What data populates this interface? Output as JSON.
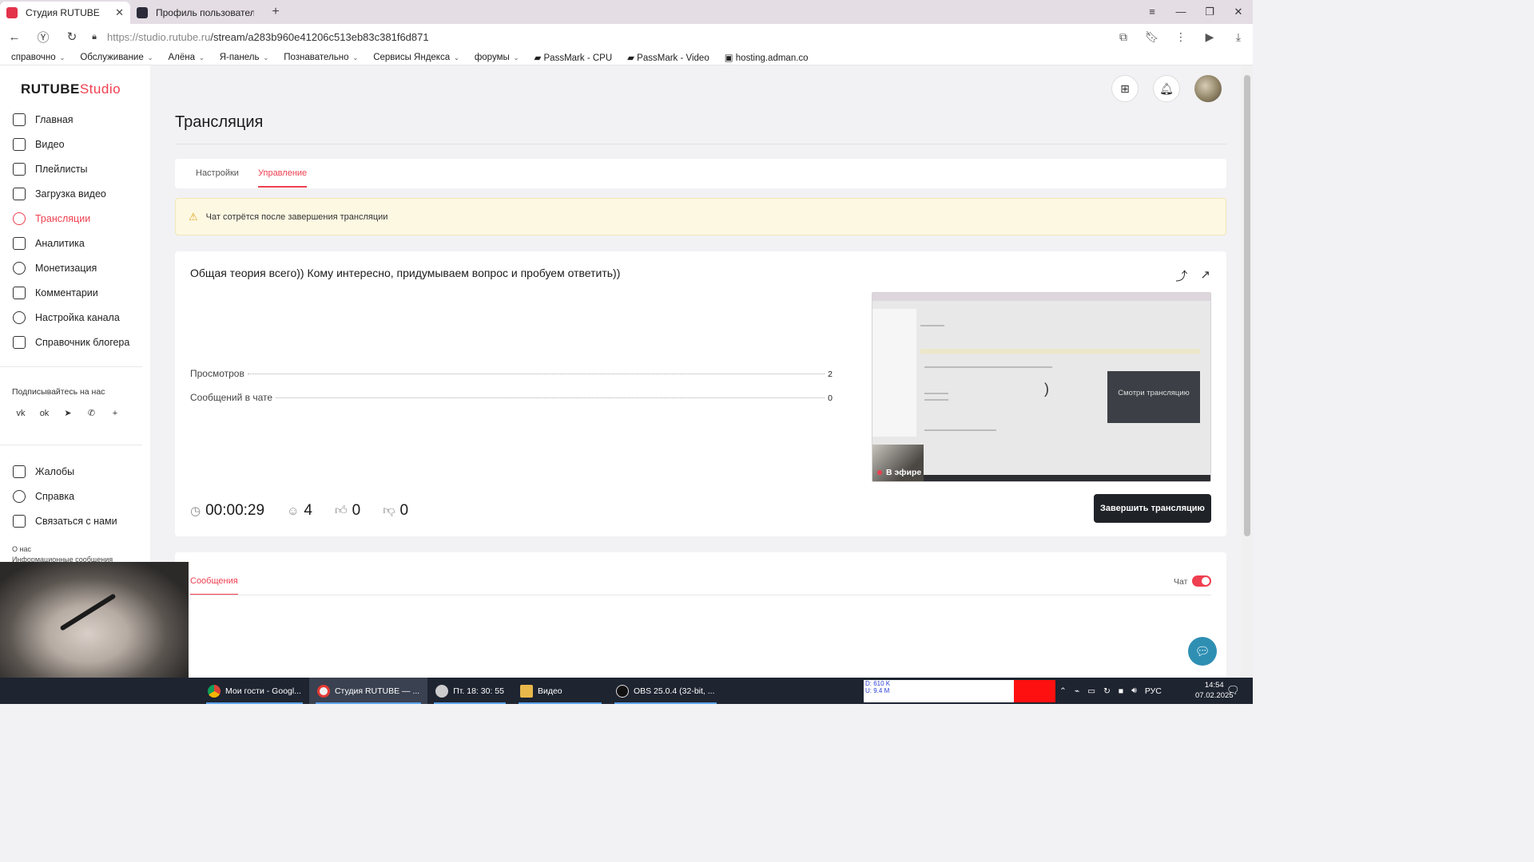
{
  "browser": {
    "tabs": [
      {
        "title": "Студия RUTUBE",
        "favicon_color": "#e3324a"
      },
      {
        "title": "Профиль пользователя К",
        "favicon_color": "#2b2b3a"
      }
    ],
    "url_host": "https://studio.rutube.ru",
    "url_path": "/stream/a283b960e41206c513eb83c381f6d871",
    "bookmarks": [
      "справочно",
      "Обслуживание",
      "Алёна",
      "Я-панель",
      "Познавательно",
      "Сервисы Яндекса",
      "форумы",
      "PassMark - CPU",
      "PassMark - Video",
      "hosting.adman.co"
    ]
  },
  "logo": {
    "main": "RUTUBE",
    "sub": "Studio"
  },
  "sidebar": {
    "items": [
      {
        "label": "Главная"
      },
      {
        "label": "Видео"
      },
      {
        "label": "Плейлисты"
      },
      {
        "label": "Загрузка видео"
      },
      {
        "label": "Трансляции"
      },
      {
        "label": "Аналитика"
      },
      {
        "label": "Монетизация"
      },
      {
        "label": "Комментарии"
      },
      {
        "label": "Настройка канала"
      },
      {
        "label": "Справочник блогера"
      }
    ],
    "subscribe_title": "Подписывайтесь на нас",
    "socials": [
      "vk",
      "ok",
      "tg",
      "viber",
      "+"
    ],
    "bottom_items": [
      {
        "label": "Жалобы"
      },
      {
        "label": "Справка"
      },
      {
        "label": "Связаться с нами"
      }
    ],
    "about": "О нас",
    "info_messages": "Информационные сообщения"
  },
  "page": {
    "title": "Трансляция",
    "tabs": [
      "Настройки",
      "Управление"
    ],
    "active_tab": "Управление",
    "warning": "Чат сотрётся после завершения трансляции"
  },
  "stream": {
    "title": "Общая теория всего)) Кому интересно, придумываем вопрос и пробуем ответить))",
    "stats": [
      {
        "label": "Просмотров",
        "value": "2"
      },
      {
        "label": "Сообщений в чате",
        "value": "0"
      }
    ],
    "duration": "00:00:29",
    "viewers": "4",
    "likes": "0",
    "dislikes": "0",
    "preview_overlay": "Смотри трансляцию",
    "live_label": "В эфире",
    "end_button": "Завершить трансляцию"
  },
  "chat": {
    "tab": "Сообщения",
    "toggle_label": "Чат",
    "enabled": true
  },
  "taskbar": {
    "items": [
      "Мои гости - Googl...",
      "Студия RUTUBE — ...",
      "Пт. 18: 30: 55",
      "Видео",
      "OBS 25.0.4 (32-bit, ..."
    ],
    "net_down": "D: 610 K",
    "net_up": "U: 9.4 M",
    "lang": "РУС",
    "time": "14:54",
    "date": "07.02.2025"
  },
  "colors": {
    "accent": "#ef3f50",
    "dark_button": "#1f2328",
    "warning_bg": "#fcf8e2"
  }
}
